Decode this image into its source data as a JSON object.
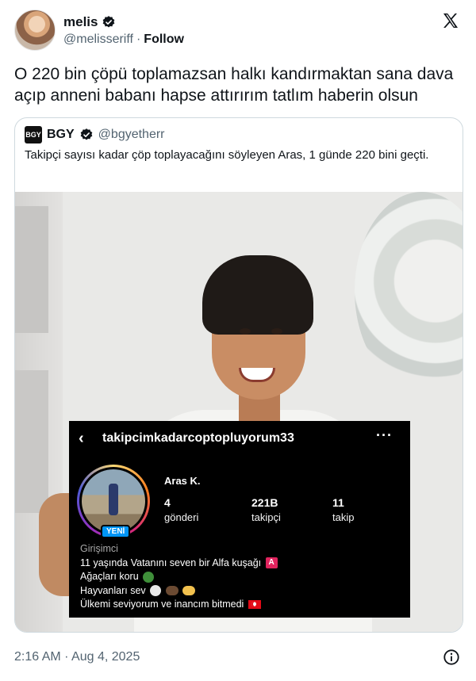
{
  "author": {
    "name": "melis",
    "handle": "@melisseriff",
    "separator": "·",
    "follow_label": "Follow"
  },
  "tweet": {
    "text": "O 220 bin çöpü toplamazsan halkı kandırmaktan sana dava açıp anneni babanı hapse attırırım tatlım haberin olsun"
  },
  "quoted": {
    "avatar_text": "BGY",
    "name": "BGY",
    "handle": "@bgyetherr",
    "text": "Takipçi sayısı kadar çöp toplayacağını söyleyen Aras, 1 günde 220 bini geçti."
  },
  "instagram": {
    "back_icon": "‹",
    "username": "takipcimkadarcoptopluyorum33",
    "more_icon": "···",
    "new_badge": "YENİ",
    "full_name": "Aras K.",
    "stats": [
      {
        "value": "4",
        "label": "gönderi"
      },
      {
        "value": "221B",
        "label": "takipçi"
      },
      {
        "value": "11",
        "label": "takip"
      }
    ],
    "bio": {
      "category": "Girişimci",
      "line1": "11 yaşında Vatanını seven bir Alfa kuşağı",
      "line1_badge": "A",
      "line2": "Ağaçları koru",
      "line3": "Hayvanları sev",
      "line4": "Ülkemi seviyorum ve inancım bitmedi"
    },
    "emojis": [
      "red-a-badge",
      "tree-emoji",
      "rabbit-emoji",
      "boar-emoji",
      "heart-hands-emoji",
      "turkish-flag-emoji"
    ]
  },
  "footer": {
    "timestamp": "2:16 AM · Aug 4, 2025"
  },
  "colors": {
    "text": "#0f1419",
    "muted": "#536471",
    "border": "#cfd9de",
    "verified": "#0f1419",
    "ig_background": "#000000",
    "ig_new_badge": "#0095f6"
  }
}
